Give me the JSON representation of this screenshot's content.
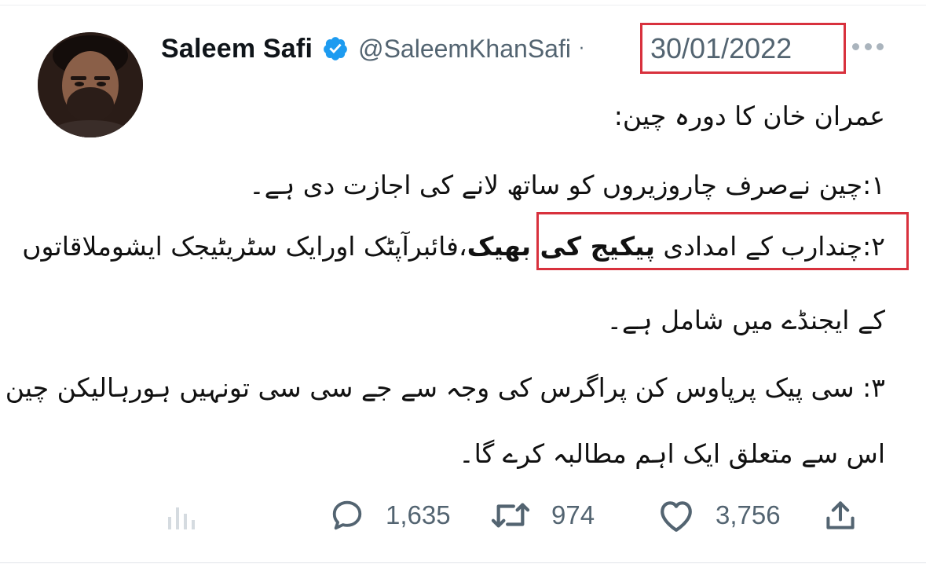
{
  "tweet": {
    "author": {
      "display_name": "Saleem Safi",
      "handle": "@SaleemKhanSafi",
      "verified": true
    },
    "separator": "·",
    "date": "30/01/2022",
    "lines": [
      "عمران خان کا دورہ چین:",
      "۱:چین نےصرف چاروزیروں کو ساتھ لانے کی اجازت دی ہے۔",
      "۲:چندارب کے امدادی پیکیج کی بھیک،فائبرآپٹک اورایک سٹریٹیجک ایشوملاقاتوں",
      "کے ایجنڈے میں شامل ہے۔",
      "۳: سی پیک پرپاوس کن پراگرس کی وجہ سے جے سی سی تونہیں ہورہالیکن چین",
      "اس سے متعلق ایک اہم مطالبہ کرے گا۔"
    ],
    "line2_parts": {
      "before": "۲:چندارب کے امدادی ",
      "bold": "پیکیج کی بھیک",
      "after": "،فائبرآپٹک اورایک سٹریٹیجک ایشوملاقاتوں"
    },
    "stats": {
      "replies": "1,635",
      "retweets": "974",
      "likes": "3,756"
    }
  },
  "icons": {
    "more": "more-horizontal-icon",
    "verified": "verified-badge-icon",
    "analytics": "analytics-icon",
    "reply": "reply-icon",
    "retweet": "retweet-icon",
    "like": "heart-icon",
    "share": "share-icon"
  },
  "colors": {
    "annotation": "#d8313d",
    "verified": "#1d9bf0",
    "muted": "#536471"
  }
}
